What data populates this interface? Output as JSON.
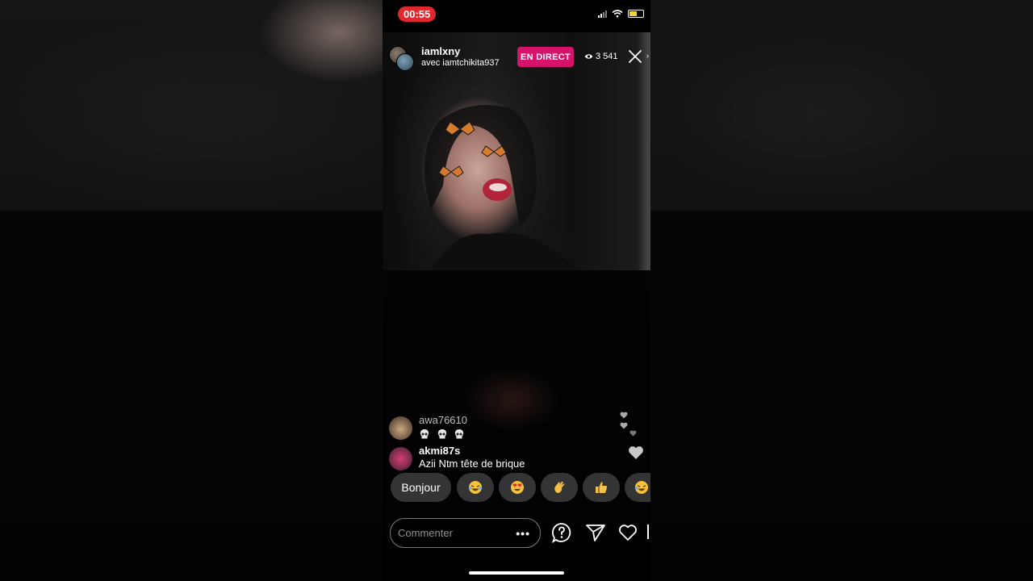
{
  "status_bar": {
    "time": "00:55"
  },
  "live_header": {
    "host": "iamlxny",
    "guest_line": "avec iamtchikita937",
    "live_badge": "EN DIRECT",
    "viewers": "3 541"
  },
  "comments": [
    {
      "username": "awa76610",
      "text": "",
      "emoji": [
        "skull-icon",
        "skull-icon",
        "skull-icon"
      ]
    },
    {
      "username": "akmi87s",
      "text": "Azii Ntm tête de brique"
    }
  ],
  "quick_replies": {
    "text_pill": "Bonjour",
    "emojis": [
      "laughing-tears-icon",
      "heart-eyes-icon",
      "waving-hand-icon",
      "thumbs-up-icon",
      "laughing-tears-icon"
    ]
  },
  "bottom_bar": {
    "comment_placeholder": "Commenter",
    "more_label": "•••"
  },
  "colors": {
    "live_badge": "#d6136b",
    "status_time_bg": "#e0282e",
    "background": "#000000"
  }
}
